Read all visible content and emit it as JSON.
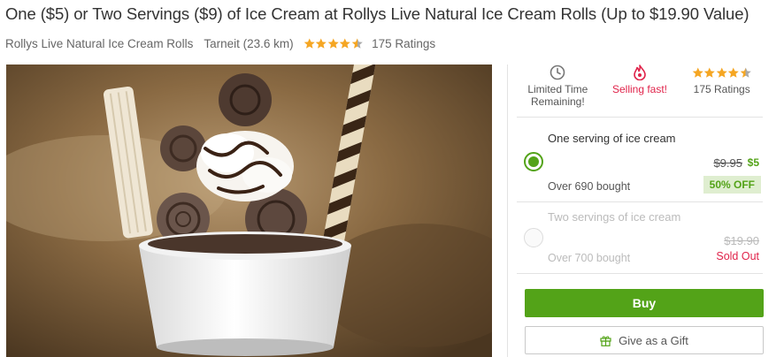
{
  "deal": {
    "title": "One ($5) or Two Servings ($9) of Ice Cream at Rollys Live Natural Ice Cream Rolls (Up to $19.90 Value)",
    "merchant": "Rollys Live Natural Ice Cream Rolls",
    "location": "Tarneit (23.6 km)",
    "rating": 4.5,
    "ratings_count": "175 Ratings"
  },
  "hero_image": {
    "icon": "ice-cream-photo"
  },
  "badges": [
    {
      "icon": "clock-icon",
      "label": "Limited Time Remaining!"
    },
    {
      "icon": "flame-icon",
      "label": "Selling fast!",
      "color": "#e0234a"
    },
    {
      "icon": "stars",
      "rating": 4.5,
      "label": "175 Ratings"
    }
  ],
  "options": [
    {
      "name": "One serving of ice cream",
      "original_price": "$9.95",
      "price": "$5",
      "bought": "Over 690 bought",
      "discount": "50% OFF",
      "selected": true
    },
    {
      "name": "Two servings of ice cream",
      "original_price": "$19.90",
      "bought": "Over 700 bought",
      "status": "Sold Out",
      "selected": false
    }
  ],
  "actions": {
    "buy_label": "Buy",
    "gift_label": "Give as a Gift"
  },
  "colors": {
    "accent_green": "#53a318",
    "alert_red": "#e0234a",
    "star_gold": "#f5a623"
  }
}
